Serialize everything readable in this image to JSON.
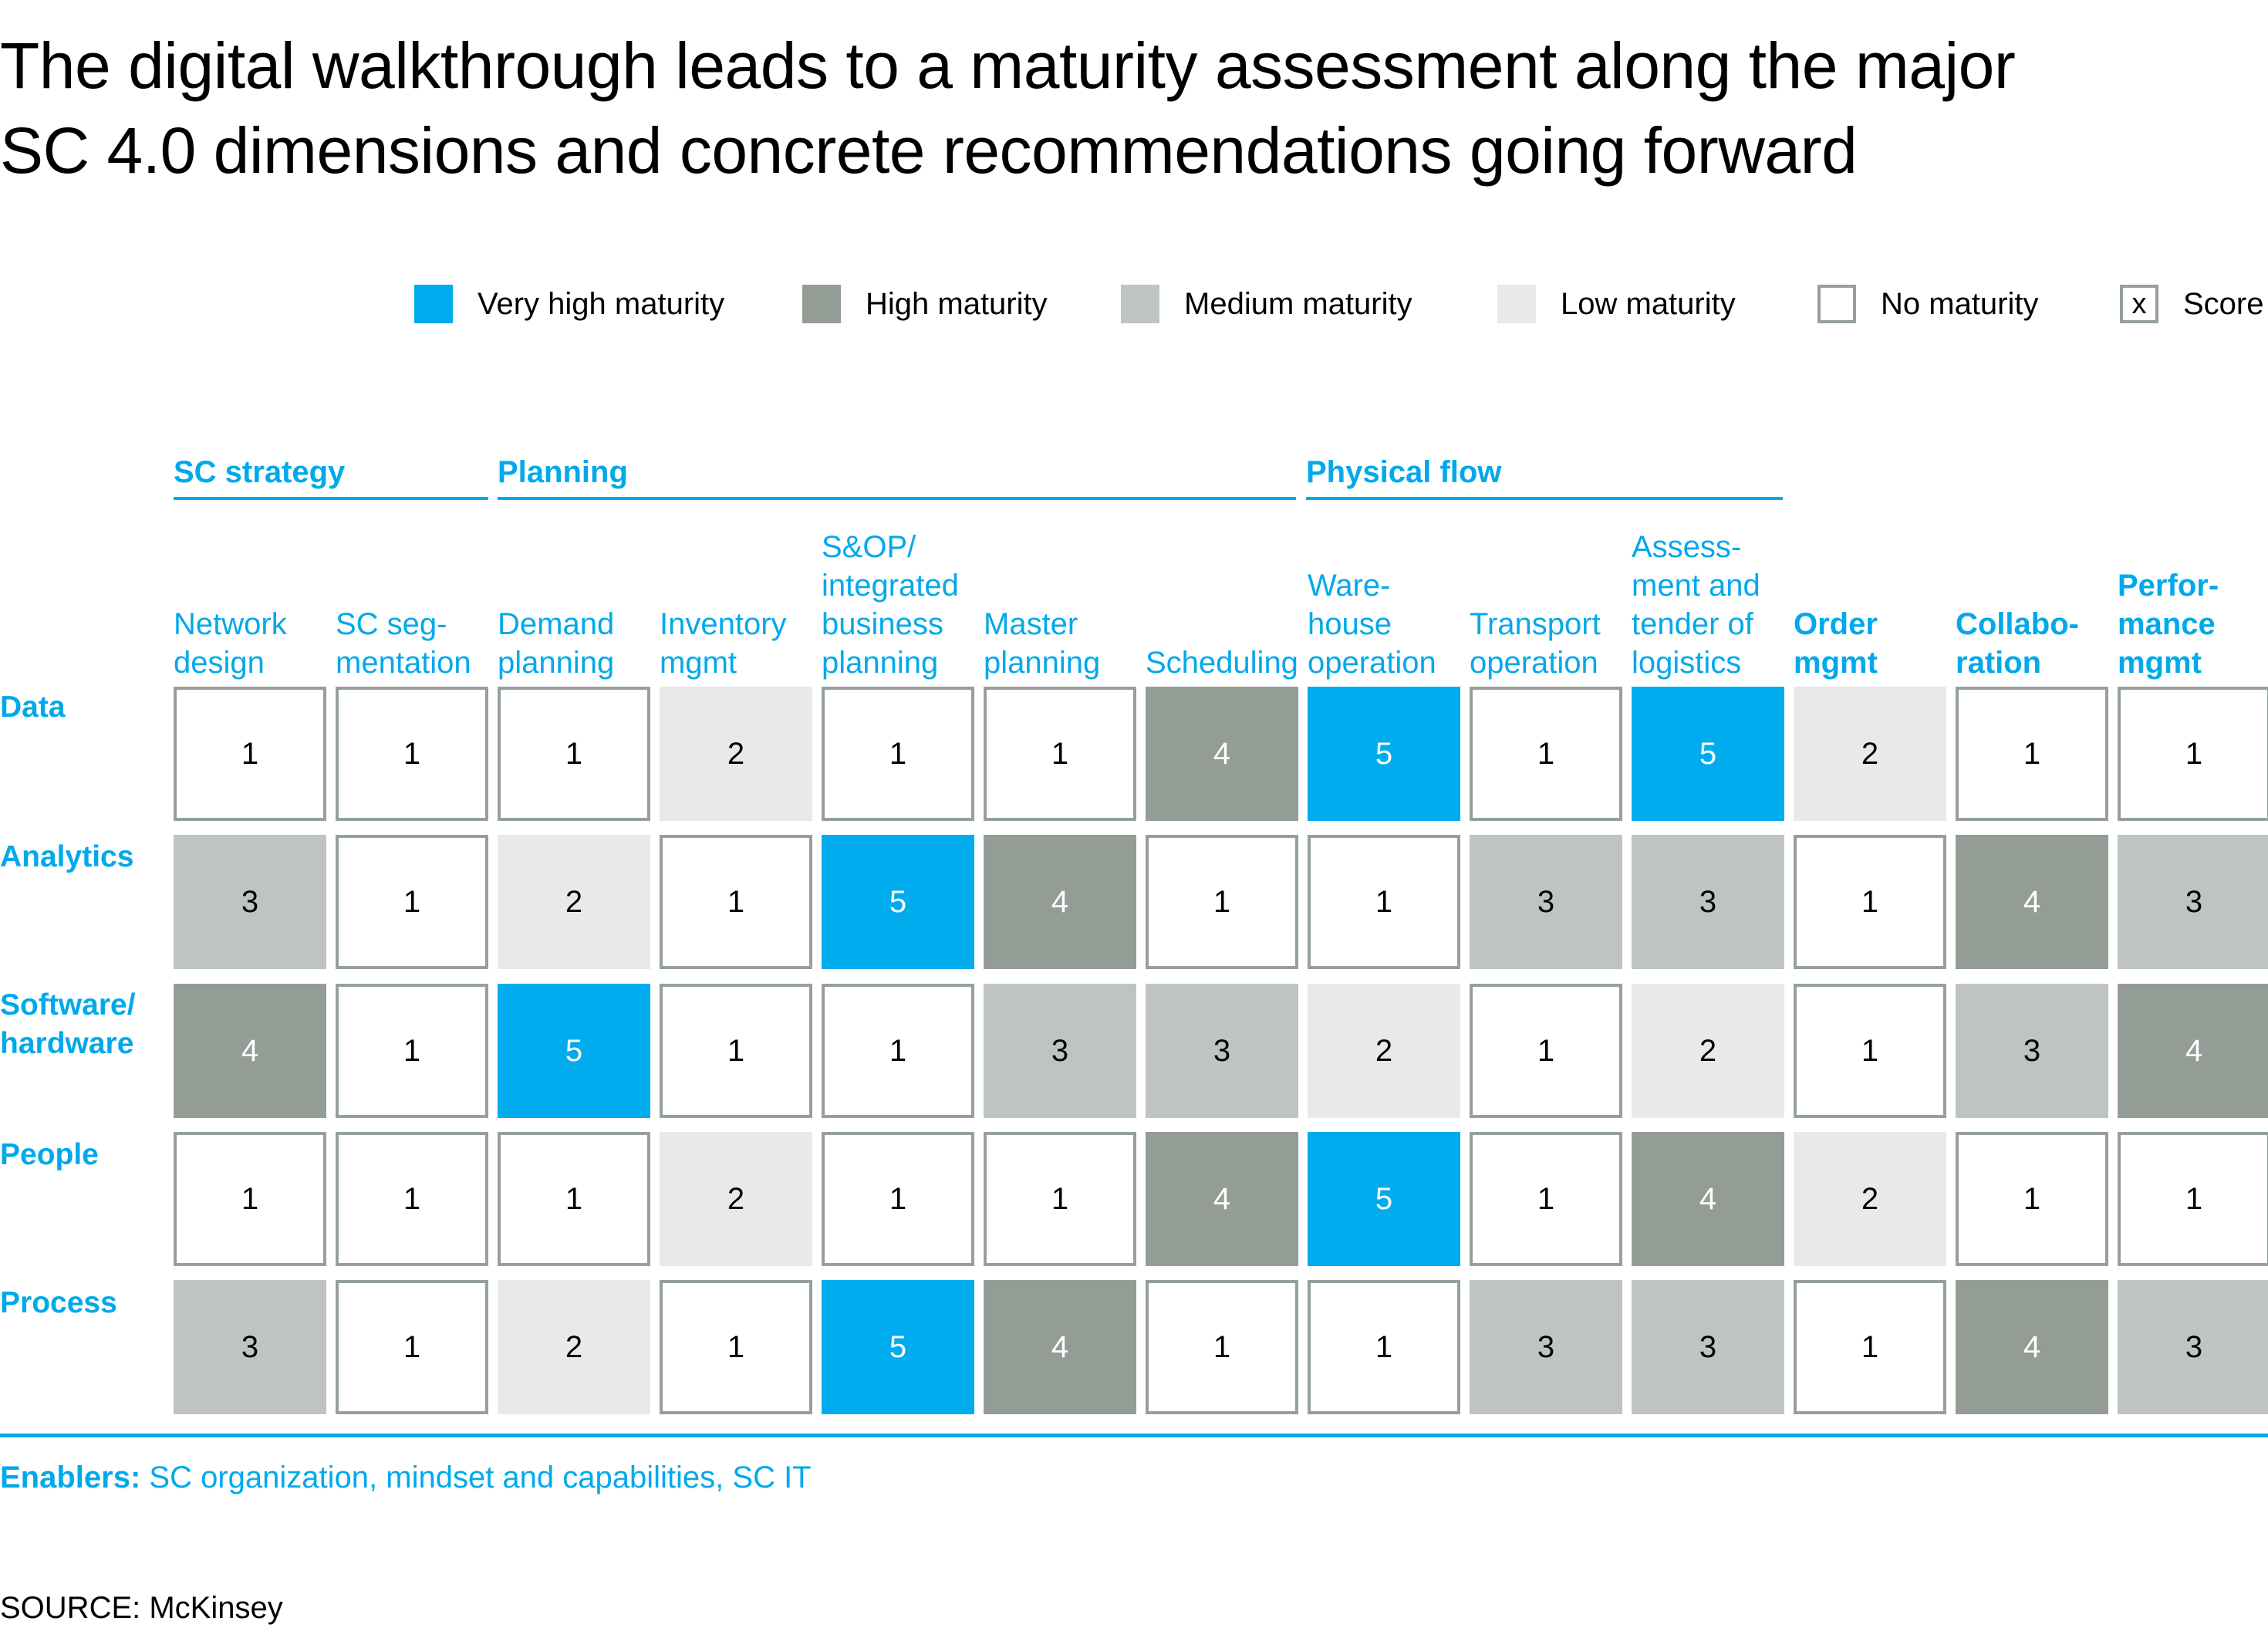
{
  "title": {
    "line1": "The digital walkthrough leads to a maturity assessment along the major",
    "line2": "SC 4.0 dimensions and concrete recommendations going forward"
  },
  "legend": [
    {
      "label": "Very high maturity",
      "level": 5,
      "symbol": ""
    },
    {
      "label": "High maturity",
      "level": 4,
      "symbol": ""
    },
    {
      "label": "Medium maturity",
      "level": 3,
      "symbol": ""
    },
    {
      "label": "Low maturity",
      "level": 2,
      "symbol": ""
    },
    {
      "label": "No maturity",
      "level": 1,
      "symbol": ""
    },
    {
      "label": "Score",
      "level": 1,
      "symbol": "x"
    }
  ],
  "colors": {
    "very_high": "#00aced",
    "high": "#949c96",
    "medium": "#bec4c2",
    "low": "#e8e9e9",
    "none": "#ffffff",
    "accent": "#00a9ea"
  },
  "chart_data": {
    "type": "heatmap",
    "title": "The digital walkthrough leads to a maturity assessment along the major SC 4.0 dimensions and concrete recommendations going forward",
    "groups": [
      {
        "label": "SC strategy",
        "columns": [
          "Network design",
          "SC segmentation"
        ]
      },
      {
        "label": "Planning",
        "columns": [
          "Demand planning",
          "Inventory mgmt",
          "S&OP/integrated business planning",
          "Master planning",
          "Scheduling"
        ]
      },
      {
        "label": "Physical flow",
        "columns": [
          "Warehouse operation",
          "Transport operation",
          "Assessment and tender of logistics"
        ]
      },
      {
        "label": "",
        "columns": [
          "Order mgmt",
          "Collaboration",
          "Performance mgmt"
        ]
      }
    ],
    "columns": [
      {
        "label": "Network\ndesign",
        "bold": false
      },
      {
        "label": "SC seg-\nmentation",
        "bold": false
      },
      {
        "label": "Demand\nplanning",
        "bold": false
      },
      {
        "label": "Inventory\nmgmt",
        "bold": false
      },
      {
        "label": "S&OP/\nintegrated\nbusiness\nplanning",
        "bold": false
      },
      {
        "label": "Master\nplanning",
        "bold": false
      },
      {
        "label": "Scheduling",
        "bold": false
      },
      {
        "label": "Ware-\nhouse\noperation",
        "bold": false
      },
      {
        "label": "Transport\noperation",
        "bold": false
      },
      {
        "label": "Assess-\nment and\ntender of\nlogistics",
        "bold": false
      },
      {
        "label": "Order\nmgmt",
        "bold": true
      },
      {
        "label": "Collabo-\nration",
        "bold": true
      },
      {
        "label": "Perfor-\nmance\nmgmt",
        "bold": true
      }
    ],
    "rows": [
      "Data",
      "Analytics",
      "Software/\nhardware",
      "People",
      "Process"
    ],
    "values": [
      [
        1,
        1,
        1,
        2,
        1,
        1,
        4,
        5,
        1,
        5,
        2,
        1,
        1
      ],
      [
        3,
        1,
        2,
        1,
        5,
        4,
        1,
        1,
        3,
        3,
        1,
        4,
        3
      ],
      [
        4,
        1,
        5,
        1,
        1,
        3,
        3,
        2,
        1,
        2,
        1,
        3,
        4
      ],
      [
        1,
        1,
        1,
        2,
        1,
        1,
        4,
        5,
        1,
        4,
        2,
        1,
        1
      ],
      [
        3,
        1,
        2,
        1,
        5,
        4,
        1,
        1,
        3,
        3,
        1,
        4,
        3
      ]
    ],
    "scale": {
      "1": "No maturity",
      "2": "Low maturity",
      "3": "Medium maturity",
      "4": "High maturity",
      "5": "Very high maturity"
    }
  },
  "footer": {
    "enablers_label": "Enablers:",
    "enablers_text": " SC organization, mindset and capabilities, SC IT",
    "source": "SOURCE: McKinsey"
  }
}
